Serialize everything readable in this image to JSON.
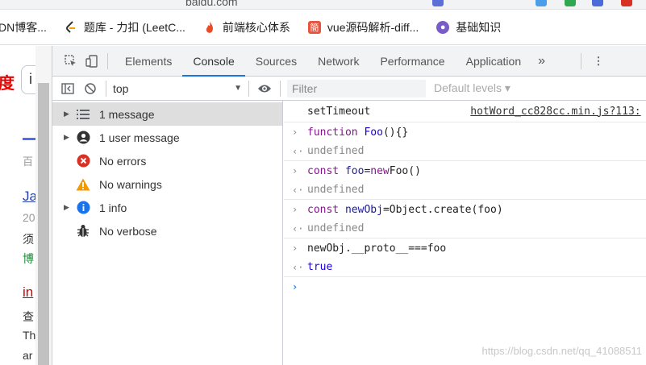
{
  "browser": {
    "url_fragment": "baidu.com",
    "bookmarks": [
      {
        "label": "DN博客...",
        "icon": "csdn-icon"
      },
      {
        "label": "题库 - 力扣 (LeetC...",
        "icon": "leetcode-icon"
      },
      {
        "label": "前端核心体系",
        "icon": "flame-icon"
      },
      {
        "label": "vue源码解析-diff...",
        "icon": "bookmark-red-icon"
      },
      {
        "label": "基础知识",
        "icon": "earth-icon"
      }
    ]
  },
  "page_strip": {
    "logo_char": "度",
    "input_char": "i",
    "line1": "百",
    "link1": "Ja",
    "line2": "20",
    "line3": "须",
    "line4": "博",
    "link2": "in",
    "line5": "查",
    "line6": "Th",
    "line7": "ar"
  },
  "devtools": {
    "tabs": [
      "Elements",
      "Console",
      "Sources",
      "Network",
      "Performance",
      "Application"
    ],
    "active_tab": "Console",
    "more": "»",
    "context": "top",
    "filter_placeholder": "Filter",
    "levels": "Default levels ▾",
    "sidebar": [
      {
        "label": "1 message",
        "icon": "list-icon",
        "expandable": true
      },
      {
        "label": "1 user message",
        "icon": "user-icon",
        "expandable": true
      },
      {
        "label": "No errors",
        "icon": "error-icon",
        "expandable": false
      },
      {
        "label": "No warnings",
        "icon": "warning-icon",
        "expandable": false
      },
      {
        "label": "1 info",
        "icon": "info-icon",
        "expandable": true
      },
      {
        "label": "No verbose",
        "icon": "bug-icon",
        "expandable": false
      }
    ],
    "console": {
      "setTimeout": "setTimeout",
      "source_link": "hotWord_cc828cc.min.js?113:",
      "in1_kw": "function",
      "in1_name": "Foo",
      "in1_rest": "(){}",
      "out1": "undefined",
      "in2_kw": "const",
      "in2_var": "foo",
      "in2_eq": "=",
      "in2_new": "new",
      "in2_rest": " Foo()",
      "out2": "undefined",
      "in3_kw": "const",
      "in3_var": "newObj",
      "in3_rest": "=Object.create(foo)",
      "out3": "undefined",
      "in4": "newObj.__proto__===foo",
      "out4": "true"
    },
    "watermark": "https://blog.csdn.net/qq_41088511"
  },
  "colors": {
    "accent": "#1a73e8",
    "error": "#d93025",
    "warning": "#f29900",
    "info": "#1a73e8"
  }
}
